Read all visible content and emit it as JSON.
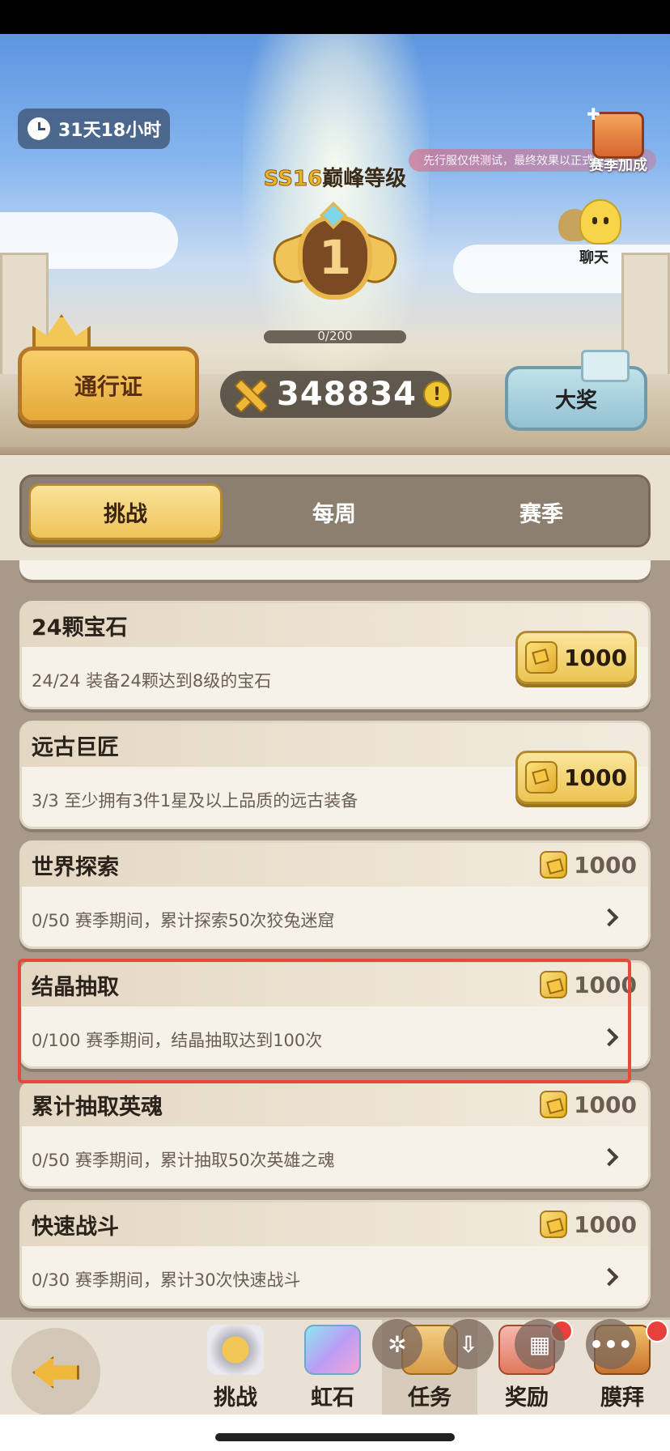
{
  "hero": {
    "timer": "31天18小时",
    "test_notice": "先行服仅供测试，最终效果以正式服为准",
    "season_bonus_label": "赛季加成",
    "chat_label": "聊天",
    "level_prefix": "SS16",
    "level_suffix": "巅峰等级",
    "level_number": "1",
    "progress_text": "0/200",
    "progress_fraction": 0,
    "pass_button": "通行证",
    "score": "348834",
    "info_glyph": "!",
    "grand_prize_button": "大奖"
  },
  "tabs": [
    {
      "label": "挑战",
      "active": true
    },
    {
      "label": "每周",
      "active": false
    },
    {
      "label": "赛季",
      "active": false
    }
  ],
  "tasks": [
    {
      "title": "24颗宝石",
      "desc": "24/24 装备24颗达到8级的宝石",
      "reward": "1000",
      "claimable": true
    },
    {
      "title": "远古巨匠",
      "desc": "3/3 至少拥有3件1星及以上品质的远古装备",
      "reward": "1000",
      "claimable": true
    },
    {
      "title": "世界探索",
      "desc": "0/50 赛季期间，累计探索50次狡兔迷窟",
      "reward": "1000",
      "claimable": false
    },
    {
      "title": "结晶抽取",
      "desc": "0/100 赛季期间，结晶抽取达到100次",
      "reward": "1000",
      "claimable": false
    },
    {
      "title": "累计抽取英魂",
      "desc": "0/50 赛季期间，累计抽取50次英雄之魂",
      "reward": "1000",
      "claimable": false
    },
    {
      "title": "快速战斗",
      "desc": "0/30 赛季期间，累计30次快速战斗",
      "reward": "1000",
      "claimable": false
    }
  ],
  "nav": [
    {
      "label": "挑战",
      "icon": "swords-shield-icon"
    },
    {
      "label": "虹石",
      "icon": "rainbow-stone-icon"
    },
    {
      "label": "任务",
      "icon": "scroll-icon",
      "active": true
    },
    {
      "label": "奖励",
      "icon": "chest-icon"
    },
    {
      "label": "膜拜",
      "icon": "idol-icon"
    }
  ],
  "overlay_buttons": {
    "fab1": "✲",
    "fab2": "⇩",
    "fab3": "▦",
    "fab4": "•••"
  },
  "colors": {
    "accent_gold": "#eec45a",
    "highlight_red": "#e8473a",
    "list_bg": "#a8998a"
  }
}
